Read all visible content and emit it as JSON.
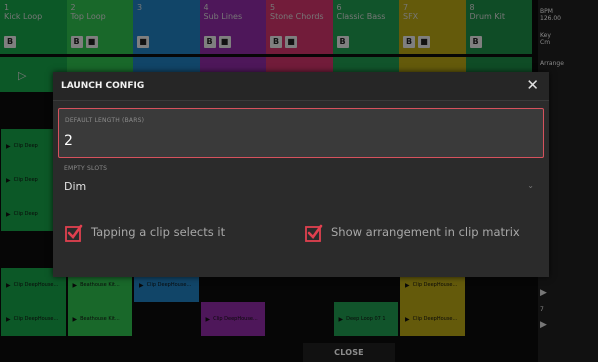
{
  "tracks": [
    {
      "num": "1",
      "name": "Kick Loop",
      "color": "#16a047",
      "buttons": [
        "B"
      ]
    },
    {
      "num": "2",
      "name": "Top Loop",
      "color": "#2fbe4e",
      "buttons": [
        "B",
        "■"
      ]
    },
    {
      "num": "3",
      "name": "",
      "color": "#1f7fbe",
      "buttons": [
        "■"
      ]
    },
    {
      "num": "4",
      "name": "Sub Lines",
      "color": "#8f2aa4",
      "buttons": [
        "B",
        "■"
      ]
    },
    {
      "num": "5",
      "name": "Stone Chords",
      "color": "#d0346a",
      "buttons": [
        "B",
        "■"
      ]
    },
    {
      "num": "6",
      "name": "Classic Bass",
      "color": "#1f9a4f",
      "buttons": [
        "B"
      ]
    },
    {
      "num": "7",
      "name": "SFX",
      "color": "#b6a414",
      "buttons": [
        "B",
        "■"
      ]
    },
    {
      "num": "8",
      "name": "Drum Kit",
      "color": "#1c8a46",
      "buttons": [
        "B"
      ]
    }
  ],
  "right_panel": {
    "tempo_label": "BPM",
    "tempo_value": "126.00",
    "key_label": "Key",
    "key_value": "Cm",
    "arrange_label": "Arrange",
    "scene_number": "7"
  },
  "clips": {
    "row1": [
      "Clip Deep",
      "",
      "",
      "",
      "",
      "",
      "",
      ""
    ],
    "row2": [
      "Clip Deep",
      "",
      "",
      "",
      "",
      "",
      "",
      ""
    ],
    "row3": [
      "Clip Deep",
      "",
      "",
      "",
      "",
      "",
      "",
      ""
    ],
    "row4": [
      "Clip DeepHouse...",
      "Beathouse Kit...",
      "Clip DeepHouse...",
      "",
      "",
      "",
      "Clip DeepHouse...",
      ""
    ],
    "row5": [
      "Clip DeepHouse...",
      "Beathouse Kit...",
      "",
      "Clip DeepHouse...",
      "",
      "Deep Loop 07 1",
      "Clip DeepHouse...",
      ""
    ]
  },
  "dialog": {
    "title": "LAUNCH CONFIG",
    "close_icon": "close-icon",
    "default_length_label": "DEFAULT LENGTH (BARS)",
    "default_length_value": "2",
    "empty_slots_label": "EMPTY SLOTS",
    "empty_slots_value": "Dim",
    "checkbox1_label": "Tapping a clip selects it",
    "checkbox1_checked": true,
    "checkbox2_label": "Show arrangement in clip matrix",
    "checkbox2_checked": true,
    "accent": "#e0404f"
  },
  "footer": {
    "close_label": "CLOSE"
  }
}
